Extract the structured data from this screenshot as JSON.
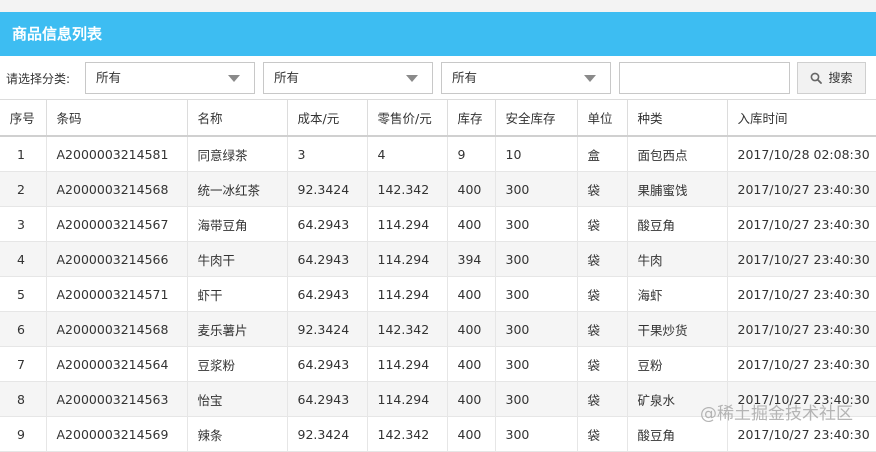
{
  "header": {
    "title": "商品信息列表"
  },
  "filters": {
    "label": "请选择分类:",
    "selects": [
      "所有",
      "所有",
      "所有"
    ],
    "search_value": "",
    "search_button": "搜索"
  },
  "table": {
    "columns": [
      "序号",
      "条码",
      "名称",
      "成本/元",
      "零售价/元",
      "库存",
      "安全库存",
      "单位",
      "种类",
      "入库时间"
    ],
    "rows": [
      [
        "1",
        "A2000003214581",
        "同意绿茶",
        "3",
        "4",
        "9",
        "10",
        "盒",
        "面包西点",
        "2017/10/28 02:08:30"
      ],
      [
        "2",
        "A2000003214568",
        "统一冰红茶",
        "92.3424",
        "142.342",
        "400",
        "300",
        "袋",
        "果脯蜜饯",
        "2017/10/27 23:40:30"
      ],
      [
        "3",
        "A2000003214567",
        "海带豆角",
        "64.2943",
        "114.294",
        "400",
        "300",
        "袋",
        "酸豆角",
        "2017/10/27 23:40:30"
      ],
      [
        "4",
        "A2000003214566",
        "牛肉干",
        "64.2943",
        "114.294",
        "394",
        "300",
        "袋",
        "牛肉",
        "2017/10/27 23:40:30"
      ],
      [
        "5",
        "A2000003214571",
        "虾干",
        "64.2943",
        "114.294",
        "400",
        "300",
        "袋",
        "海虾",
        "2017/10/27 23:40:30"
      ],
      [
        "6",
        "A2000003214568",
        "麦乐薯片",
        "92.3424",
        "142.342",
        "400",
        "300",
        "袋",
        "干果炒货",
        "2017/10/27 23:40:30"
      ],
      [
        "7",
        "A2000003214564",
        "豆浆粉",
        "64.2943",
        "114.294",
        "400",
        "300",
        "袋",
        "豆粉",
        "2017/10/27 23:40:30"
      ],
      [
        "8",
        "A2000003214563",
        "怡宝",
        "64.2943",
        "114.294",
        "400",
        "300",
        "袋",
        "矿泉水",
        "2017/10/27 23:40:30"
      ],
      [
        "9",
        "A2000003214569",
        "辣条",
        "92.3424",
        "142.342",
        "400",
        "300",
        "袋",
        "酸豆角",
        "2017/10/27 23:40:30"
      ]
    ]
  },
  "watermark": "@稀土掘金技术社区",
  "colors": {
    "header_bg": "#3dbdf2",
    "row_alt": "#f5f5f5"
  }
}
